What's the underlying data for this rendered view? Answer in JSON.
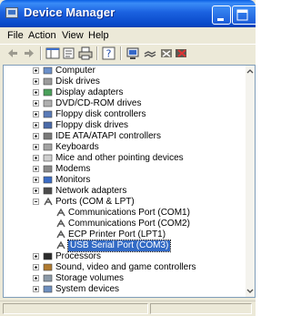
{
  "window": {
    "title": "Device Manager"
  },
  "menu": [
    {
      "label": "File"
    },
    {
      "label": "Action"
    },
    {
      "label": "View"
    },
    {
      "label": "Help"
    }
  ],
  "toolbar": [
    {
      "icon": "back-arrow-icon"
    },
    {
      "icon": "forward-arrow-icon"
    },
    {
      "icon": "show-hide-tree-icon"
    },
    {
      "icon": "properties-icon"
    },
    {
      "icon": "print-icon"
    },
    {
      "icon": "help-icon"
    },
    {
      "icon": "scan-hardware-icon"
    },
    {
      "icon": "update-driver-icon"
    },
    {
      "icon": "disable-device-icon"
    },
    {
      "icon": "uninstall-device-icon"
    }
  ],
  "tree": [
    {
      "label": "Computer",
      "expander": "plus",
      "indent": 0,
      "icon": "computer-icon"
    },
    {
      "label": "Disk drives",
      "expander": "plus",
      "indent": 0,
      "icon": "disk-drive-icon"
    },
    {
      "label": "Display adapters",
      "expander": "plus",
      "indent": 0,
      "icon": "display-adapter-icon"
    },
    {
      "label": "DVD/CD-ROM drives",
      "expander": "plus",
      "indent": 0,
      "icon": "dvd-drive-icon"
    },
    {
      "label": "Floppy disk controllers",
      "expander": "plus",
      "indent": 0,
      "icon": "floppy-controller-icon"
    },
    {
      "label": "Floppy disk drives",
      "expander": "plus",
      "indent": 0,
      "icon": "floppy-drive-icon"
    },
    {
      "label": "IDE ATA/ATAPI controllers",
      "expander": "plus",
      "indent": 0,
      "icon": "ide-controller-icon"
    },
    {
      "label": "Keyboards",
      "expander": "plus",
      "indent": 0,
      "icon": "keyboard-icon"
    },
    {
      "label": "Mice and other pointing devices",
      "expander": "plus",
      "indent": 0,
      "icon": "mouse-icon"
    },
    {
      "label": "Modems",
      "expander": "plus",
      "indent": 0,
      "icon": "modem-icon"
    },
    {
      "label": "Monitors",
      "expander": "plus",
      "indent": 0,
      "icon": "monitor-icon"
    },
    {
      "label": "Network adapters",
      "expander": "plus",
      "indent": 0,
      "icon": "network-adapter-icon"
    },
    {
      "label": "Ports (COM & LPT)",
      "expander": "minus",
      "indent": 0,
      "icon": "port-icon"
    },
    {
      "label": "Communications Port (COM1)",
      "expander": "none",
      "indent": 1,
      "icon": "port-icon"
    },
    {
      "label": "Communications Port (COM2)",
      "expander": "none",
      "indent": 1,
      "icon": "port-icon"
    },
    {
      "label": "ECP Printer Port (LPT1)",
      "expander": "none",
      "indent": 1,
      "icon": "port-icon"
    },
    {
      "label": "USB Serial Port (COM3)",
      "expander": "none",
      "indent": 1,
      "icon": "port-icon",
      "selected": true
    },
    {
      "label": "Processors",
      "expander": "plus",
      "indent": 0,
      "icon": "processor-icon"
    },
    {
      "label": "Sound, video and game controllers",
      "expander": "plus",
      "indent": 0,
      "icon": "sound-icon"
    },
    {
      "label": "Storage volumes",
      "expander": "plus",
      "indent": 0,
      "icon": "storage-volume-icon"
    },
    {
      "label": "System devices",
      "expander": "plus",
      "indent": 0,
      "icon": "system-device-icon"
    }
  ],
  "colors": {
    "titlebar": "#0a5fe3",
    "selection": "#316ac5",
    "chrome": "#ece9d8"
  }
}
